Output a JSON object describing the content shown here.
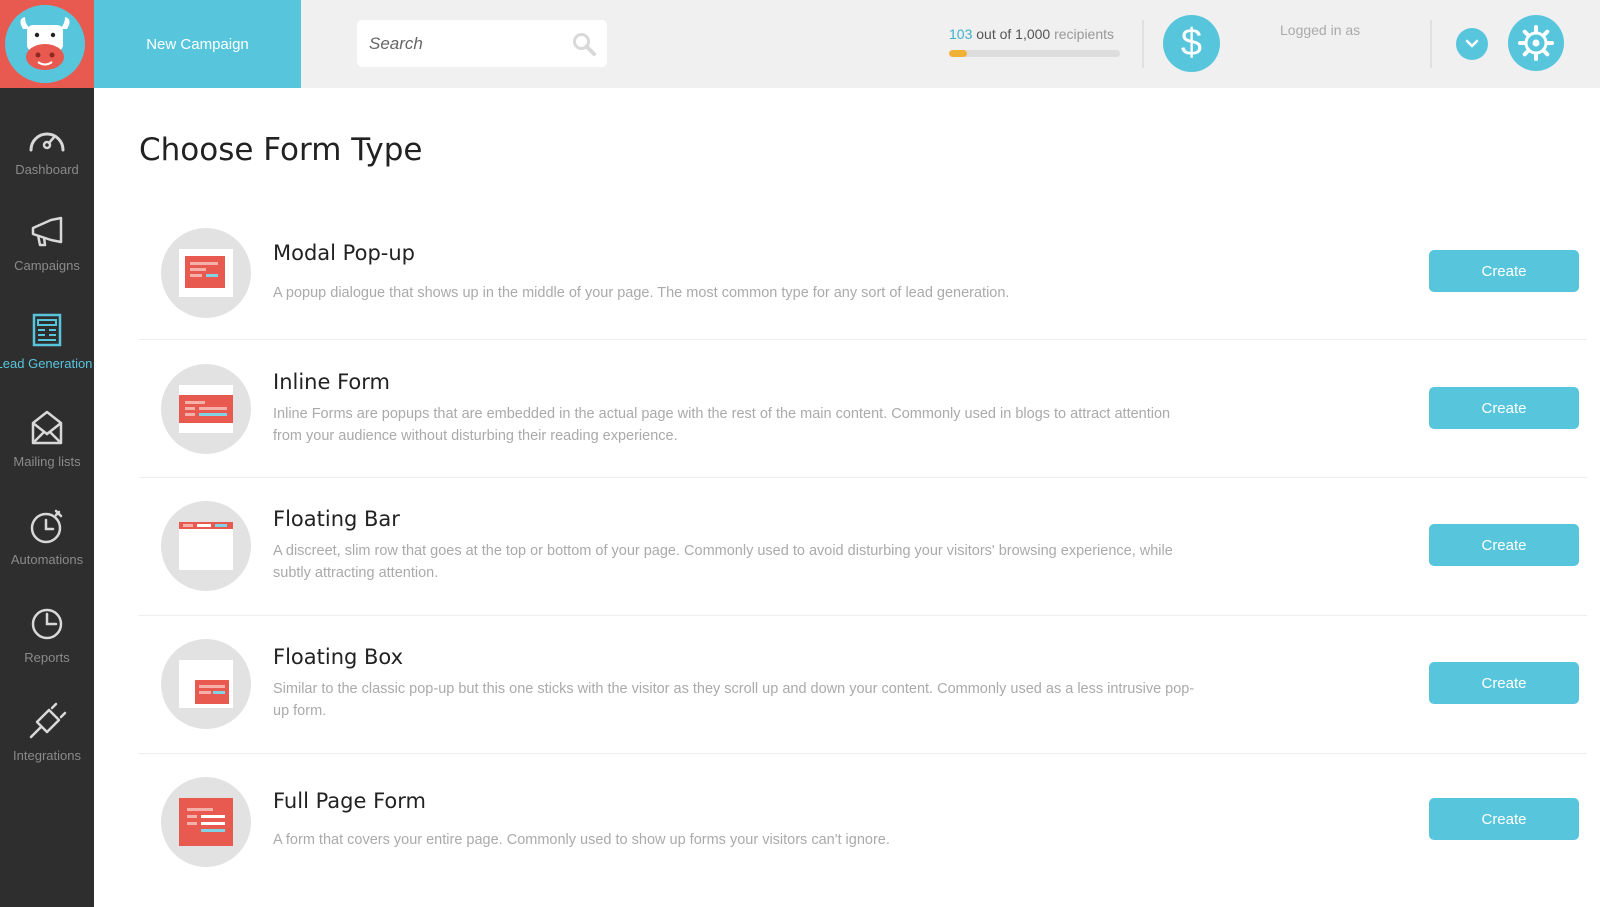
{
  "header": {
    "new_campaign_label": "New Campaign",
    "search_placeholder": "Search",
    "recipients": {
      "count": "103",
      "middle": " out of 1,000",
      "suffix": " recipients",
      "fraction": 0.103
    },
    "currency_symbol": "$",
    "logged_in_label": "Logged in as"
  },
  "sidebar": {
    "items": [
      {
        "label": "Dashboard",
        "icon": "dashboard-icon",
        "active": false
      },
      {
        "label": "Campaigns",
        "icon": "megaphone-icon",
        "active": false
      },
      {
        "label": "Lead Generation",
        "icon": "form-icon",
        "active": true
      },
      {
        "label": "Mailing lists",
        "icon": "envelope-icon",
        "active": false
      },
      {
        "label": "Automations",
        "icon": "stopwatch-icon",
        "active": false
      },
      {
        "label": "Reports",
        "icon": "clock-icon",
        "active": false
      },
      {
        "label": "Integrations",
        "icon": "plug-icon",
        "active": false
      }
    ]
  },
  "main": {
    "title": "Choose Form Type",
    "forms": [
      {
        "title": "Modal Pop-up",
        "description": "A popup dialogue that shows up in the middle of your page. The most common type for any sort of lead generation.",
        "button": "Create",
        "icon": "modal-popup-icon"
      },
      {
        "title": "Inline Form",
        "description": "Inline Forms are popups that are embedded in the actual page with the rest of the main content. Commonly used in blogs to attract attention from your audience without disturbing their reading experience.",
        "button": "Create",
        "icon": "inline-form-icon"
      },
      {
        "title": "Floating Bar",
        "description": "A discreet, slim row that goes at the top or bottom of your page. Commonly used to avoid disturbing your visitors' browsing experience, while subtly attracting attention.",
        "button": "Create",
        "icon": "floating-bar-icon"
      },
      {
        "title": "Floating Box",
        "description": "Similar to the classic pop-up but this one sticks with the visitor as they scroll up and down your content. Commonly used as a less intrusive pop-up form.",
        "button": "Create",
        "icon": "floating-box-icon"
      },
      {
        "title": "Full Page Form",
        "description": "A form that covers your entire page. Commonly used to show up forms your visitors can't ignore.",
        "button": "Create",
        "icon": "full-page-form-icon"
      }
    ]
  },
  "colors": {
    "accent": "#57c6dd",
    "brand_red": "#e85a4f",
    "sidebar_bg": "#2e2e2e",
    "progress": "#f0b236"
  }
}
